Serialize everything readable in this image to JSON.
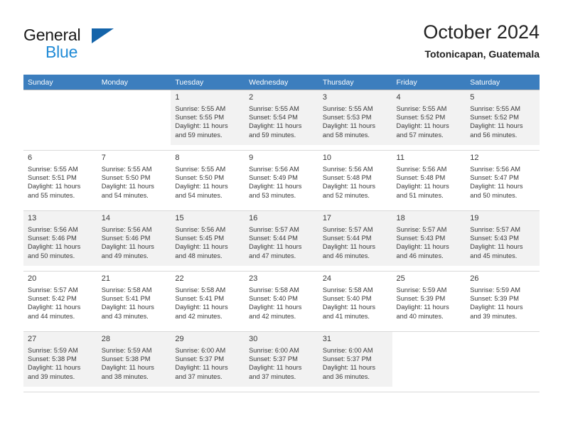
{
  "brand": {
    "word_one": "General",
    "word_two": "Blue",
    "triangle_icon": "brand-triangle-icon",
    "accent_dark": "#1464aa",
    "accent_light": "#1f8ad6"
  },
  "header": {
    "title": "October 2024",
    "subtitle": "Totonicapan, Guatemala"
  },
  "theme": {
    "header_row_bg": "#3c7ebe",
    "shaded_cell_bg": "#f2f2f2",
    "grid_line": "#b5b5b5",
    "text": "#3a3a3a"
  },
  "weekdays": [
    "Sunday",
    "Monday",
    "Tuesday",
    "Wednesday",
    "Thursday",
    "Friday",
    "Saturday"
  ],
  "weeks": [
    [
      {
        "day": "",
        "sunrise": "",
        "sunset": "",
        "daylight_line1": "",
        "daylight_line2": "",
        "empty": true
      },
      {
        "day": "",
        "sunrise": "",
        "sunset": "",
        "daylight_line1": "",
        "daylight_line2": "",
        "empty": true
      },
      {
        "day": "1",
        "sunrise": "Sunrise: 5:55 AM",
        "sunset": "Sunset: 5:55 PM",
        "daylight_line1": "Daylight: 11 hours",
        "daylight_line2": "and 59 minutes."
      },
      {
        "day": "2",
        "sunrise": "Sunrise: 5:55 AM",
        "sunset": "Sunset: 5:54 PM",
        "daylight_line1": "Daylight: 11 hours",
        "daylight_line2": "and 59 minutes."
      },
      {
        "day": "3",
        "sunrise": "Sunrise: 5:55 AM",
        "sunset": "Sunset: 5:53 PM",
        "daylight_line1": "Daylight: 11 hours",
        "daylight_line2": "and 58 minutes."
      },
      {
        "day": "4",
        "sunrise": "Sunrise: 5:55 AM",
        "sunset": "Sunset: 5:52 PM",
        "daylight_line1": "Daylight: 11 hours",
        "daylight_line2": "and 57 minutes."
      },
      {
        "day": "5",
        "sunrise": "Sunrise: 5:55 AM",
        "sunset": "Sunset: 5:52 PM",
        "daylight_line1": "Daylight: 11 hours",
        "daylight_line2": "and 56 minutes."
      }
    ],
    [
      {
        "day": "6",
        "sunrise": "Sunrise: 5:55 AM",
        "sunset": "Sunset: 5:51 PM",
        "daylight_line1": "Daylight: 11 hours",
        "daylight_line2": "and 55 minutes."
      },
      {
        "day": "7",
        "sunrise": "Sunrise: 5:55 AM",
        "sunset": "Sunset: 5:50 PM",
        "daylight_line1": "Daylight: 11 hours",
        "daylight_line2": "and 54 minutes."
      },
      {
        "day": "8",
        "sunrise": "Sunrise: 5:55 AM",
        "sunset": "Sunset: 5:50 PM",
        "daylight_line1": "Daylight: 11 hours",
        "daylight_line2": "and 54 minutes."
      },
      {
        "day": "9",
        "sunrise": "Sunrise: 5:56 AM",
        "sunset": "Sunset: 5:49 PM",
        "daylight_line1": "Daylight: 11 hours",
        "daylight_line2": "and 53 minutes."
      },
      {
        "day": "10",
        "sunrise": "Sunrise: 5:56 AM",
        "sunset": "Sunset: 5:48 PM",
        "daylight_line1": "Daylight: 11 hours",
        "daylight_line2": "and 52 minutes."
      },
      {
        "day": "11",
        "sunrise": "Sunrise: 5:56 AM",
        "sunset": "Sunset: 5:48 PM",
        "daylight_line1": "Daylight: 11 hours",
        "daylight_line2": "and 51 minutes."
      },
      {
        "day": "12",
        "sunrise": "Sunrise: 5:56 AM",
        "sunset": "Sunset: 5:47 PM",
        "daylight_line1": "Daylight: 11 hours",
        "daylight_line2": "and 50 minutes."
      }
    ],
    [
      {
        "day": "13",
        "sunrise": "Sunrise: 5:56 AM",
        "sunset": "Sunset: 5:46 PM",
        "daylight_line1": "Daylight: 11 hours",
        "daylight_line2": "and 50 minutes."
      },
      {
        "day": "14",
        "sunrise": "Sunrise: 5:56 AM",
        "sunset": "Sunset: 5:46 PM",
        "daylight_line1": "Daylight: 11 hours",
        "daylight_line2": "and 49 minutes."
      },
      {
        "day": "15",
        "sunrise": "Sunrise: 5:56 AM",
        "sunset": "Sunset: 5:45 PM",
        "daylight_line1": "Daylight: 11 hours",
        "daylight_line2": "and 48 minutes."
      },
      {
        "day": "16",
        "sunrise": "Sunrise: 5:57 AM",
        "sunset": "Sunset: 5:44 PM",
        "daylight_line1": "Daylight: 11 hours",
        "daylight_line2": "and 47 minutes."
      },
      {
        "day": "17",
        "sunrise": "Sunrise: 5:57 AM",
        "sunset": "Sunset: 5:44 PM",
        "daylight_line1": "Daylight: 11 hours",
        "daylight_line2": "and 46 minutes."
      },
      {
        "day": "18",
        "sunrise": "Sunrise: 5:57 AM",
        "sunset": "Sunset: 5:43 PM",
        "daylight_line1": "Daylight: 11 hours",
        "daylight_line2": "and 46 minutes."
      },
      {
        "day": "19",
        "sunrise": "Sunrise: 5:57 AM",
        "sunset": "Sunset: 5:43 PM",
        "daylight_line1": "Daylight: 11 hours",
        "daylight_line2": "and 45 minutes."
      }
    ],
    [
      {
        "day": "20",
        "sunrise": "Sunrise: 5:57 AM",
        "sunset": "Sunset: 5:42 PM",
        "daylight_line1": "Daylight: 11 hours",
        "daylight_line2": "and 44 minutes."
      },
      {
        "day": "21",
        "sunrise": "Sunrise: 5:58 AM",
        "sunset": "Sunset: 5:41 PM",
        "daylight_line1": "Daylight: 11 hours",
        "daylight_line2": "and 43 minutes."
      },
      {
        "day": "22",
        "sunrise": "Sunrise: 5:58 AM",
        "sunset": "Sunset: 5:41 PM",
        "daylight_line1": "Daylight: 11 hours",
        "daylight_line2": "and 42 minutes."
      },
      {
        "day": "23",
        "sunrise": "Sunrise: 5:58 AM",
        "sunset": "Sunset: 5:40 PM",
        "daylight_line1": "Daylight: 11 hours",
        "daylight_line2": "and 42 minutes."
      },
      {
        "day": "24",
        "sunrise": "Sunrise: 5:58 AM",
        "sunset": "Sunset: 5:40 PM",
        "daylight_line1": "Daylight: 11 hours",
        "daylight_line2": "and 41 minutes."
      },
      {
        "day": "25",
        "sunrise": "Sunrise: 5:59 AM",
        "sunset": "Sunset: 5:39 PM",
        "daylight_line1": "Daylight: 11 hours",
        "daylight_line2": "and 40 minutes."
      },
      {
        "day": "26",
        "sunrise": "Sunrise: 5:59 AM",
        "sunset": "Sunset: 5:39 PM",
        "daylight_line1": "Daylight: 11 hours",
        "daylight_line2": "and 39 minutes."
      }
    ],
    [
      {
        "day": "27",
        "sunrise": "Sunrise: 5:59 AM",
        "sunset": "Sunset: 5:38 PM",
        "daylight_line1": "Daylight: 11 hours",
        "daylight_line2": "and 39 minutes."
      },
      {
        "day": "28",
        "sunrise": "Sunrise: 5:59 AM",
        "sunset": "Sunset: 5:38 PM",
        "daylight_line1": "Daylight: 11 hours",
        "daylight_line2": "and 38 minutes."
      },
      {
        "day": "29",
        "sunrise": "Sunrise: 6:00 AM",
        "sunset": "Sunset: 5:37 PM",
        "daylight_line1": "Daylight: 11 hours",
        "daylight_line2": "and 37 minutes."
      },
      {
        "day": "30",
        "sunrise": "Sunrise: 6:00 AM",
        "sunset": "Sunset: 5:37 PM",
        "daylight_line1": "Daylight: 11 hours",
        "daylight_line2": "and 37 minutes."
      },
      {
        "day": "31",
        "sunrise": "Sunrise: 6:00 AM",
        "sunset": "Sunset: 5:37 PM",
        "daylight_line1": "Daylight: 11 hours",
        "daylight_line2": "and 36 minutes."
      },
      {
        "day": "",
        "sunrise": "",
        "sunset": "",
        "daylight_line1": "",
        "daylight_line2": "",
        "empty": true
      },
      {
        "day": "",
        "sunrise": "",
        "sunset": "",
        "daylight_line1": "",
        "daylight_line2": "",
        "empty": true
      }
    ]
  ]
}
